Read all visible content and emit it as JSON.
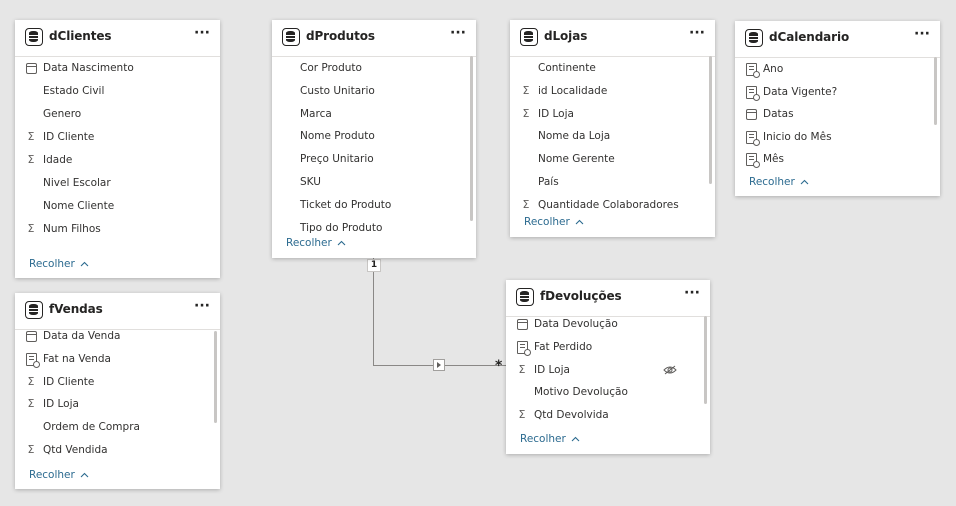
{
  "tables": {
    "dClientes": {
      "title": "dClientes",
      "fields": [
        {
          "label": "Data Nascimento",
          "icon": "calendar-icon"
        },
        {
          "label": "Estado Civil",
          "icon": ""
        },
        {
          "label": "Genero",
          "icon": ""
        },
        {
          "label": "ID Cliente",
          "icon": "sigma-icon"
        },
        {
          "label": "Idade",
          "icon": "sigma-icon"
        },
        {
          "label": "Nivel Escolar",
          "icon": ""
        },
        {
          "label": "Nome Cliente",
          "icon": ""
        },
        {
          "label": "Num Filhos",
          "icon": "sigma-icon"
        }
      ],
      "collapse_label": "Recolher"
    },
    "dProdutos": {
      "title": "dProdutos",
      "fields": [
        {
          "label": "Cor Produto",
          "icon": ""
        },
        {
          "label": "Custo Unitario",
          "icon": ""
        },
        {
          "label": "Marca",
          "icon": ""
        },
        {
          "label": "Nome Produto",
          "icon": ""
        },
        {
          "label": "Preço Unitario",
          "icon": ""
        },
        {
          "label": "SKU",
          "icon": ""
        },
        {
          "label": "Ticket do Produto",
          "icon": ""
        },
        {
          "label": "Tipo do Produto",
          "icon": ""
        }
      ],
      "collapse_label": "Recolher"
    },
    "dLojas": {
      "title": "dLojas",
      "fields": [
        {
          "label": "Continente",
          "icon": ""
        },
        {
          "label": "id Localidade",
          "icon": "sigma-icon"
        },
        {
          "label": "ID Loja",
          "icon": "sigma-icon"
        },
        {
          "label": "Nome da Loja",
          "icon": ""
        },
        {
          "label": "Nome Gerente",
          "icon": ""
        },
        {
          "label": "País",
          "icon": ""
        },
        {
          "label": "Quantidade Colaboradores",
          "icon": "sigma-icon"
        }
      ],
      "collapse_label": "Recolher"
    },
    "dCalendario": {
      "title": "dCalendario",
      "fields": [
        {
          "label": "Ano",
          "icon": "measure-icon"
        },
        {
          "label": "Data Vigente?",
          "icon": "measure-icon"
        },
        {
          "label": "Datas",
          "icon": "calendar-icon"
        },
        {
          "label": "Inicio do Mês",
          "icon": "measure-icon"
        },
        {
          "label": "Mês",
          "icon": "measure-icon"
        }
      ],
      "collapse_label": "Recolher"
    },
    "fVendas": {
      "title": "fVendas",
      "fields": [
        {
          "label": "Data da Venda",
          "icon": "calendar-icon"
        },
        {
          "label": "Fat na Venda",
          "icon": "measure-icon"
        },
        {
          "label": "ID Cliente",
          "icon": "sigma-icon"
        },
        {
          "label": "ID Loja",
          "icon": "sigma-icon"
        },
        {
          "label": "Ordem de Compra",
          "icon": ""
        },
        {
          "label": "Qtd Vendida",
          "icon": "sigma-icon"
        }
      ],
      "collapse_label": "Recolher"
    },
    "fDevolucoes": {
      "title": "fDevoluções",
      "fields": [
        {
          "label": "Data Devolução",
          "icon": "calendar-icon"
        },
        {
          "label": "Fat Perdido",
          "icon": "measure-icon"
        },
        {
          "label": "ID Loja",
          "icon": "sigma-icon",
          "hidden": true
        },
        {
          "label": "Motivo Devolução",
          "icon": ""
        },
        {
          "label": "Qtd Devolvida",
          "icon": "sigma-icon"
        }
      ],
      "collapse_label": "Recolher"
    }
  },
  "relationship": {
    "from_cardinality": "1",
    "to_cardinality": "*"
  },
  "icons": {
    "more": "···",
    "sigma": "Σ",
    "chevron_up": "^"
  }
}
